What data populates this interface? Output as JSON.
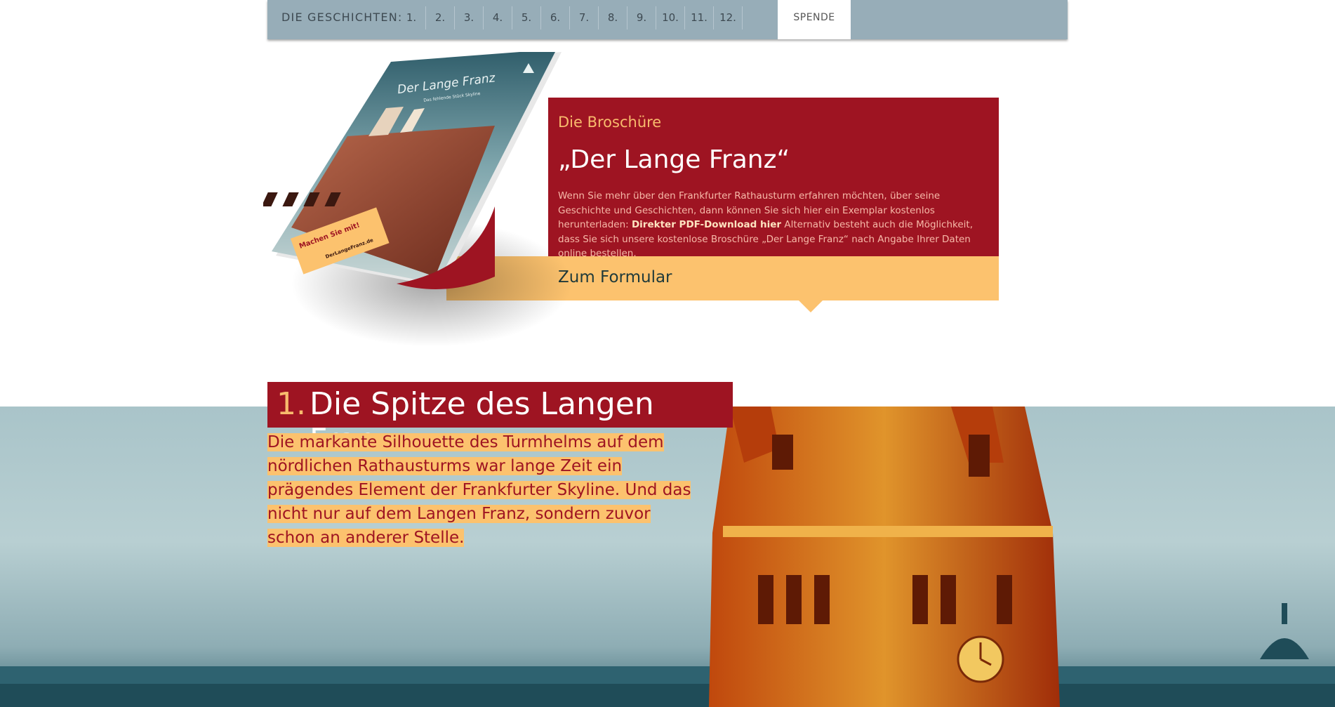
{
  "nav": {
    "title": "DIE GESCHICHTEN:",
    "items": [
      "1.",
      "2.",
      "3.",
      "4.",
      "5.",
      "6.",
      "7.",
      "8.",
      "9.",
      "10.",
      "11.",
      "12."
    ],
    "donate_label": "SPENDE"
  },
  "brochure": {
    "kicker": "Die Broschüre",
    "title": "„Der Lange Franz“",
    "body_before": "Wenn Sie mehr über den Frankfurter Rathausturm erfahren möchten, über seine Geschichte und Geschichten, dann können Sie sich hier ein Exemplar kostenlos herunterladen: ",
    "pdf_link": "Direkter PDF-Download hier",
    "body_after": " Alternativ besteht auch die Möglichkeit, dass Sie sich unsere kostenlose Broschüre „Der Lange Franz“ nach Angabe Ihrer Daten online bestellen.",
    "form_button": "Zum Formular",
    "cover": {
      "title": "Der Lange Franz",
      "subtitle": "Das fehlende Stück Skyline",
      "sticker_title": "Machen Sie mit!",
      "sticker_url": "DerLangeFranz.de"
    }
  },
  "story": {
    "number": "1.",
    "title": "Die Spitze des Langen Franz",
    "text": "Die markante Silhouette des Turmhelms auf dem nördlichen Rathausturms war lange Zeit ein prägendes Element der Frankfurter Skyline. Und das nicht nur auf dem Langen Franz, sondern zuvor schon an anderer Stelle."
  },
  "colors": {
    "nav_bg": "#97adb8",
    "crimson": "#9e1422",
    "amber": "#fcc26e",
    "kicker": "#f8bb6d"
  }
}
